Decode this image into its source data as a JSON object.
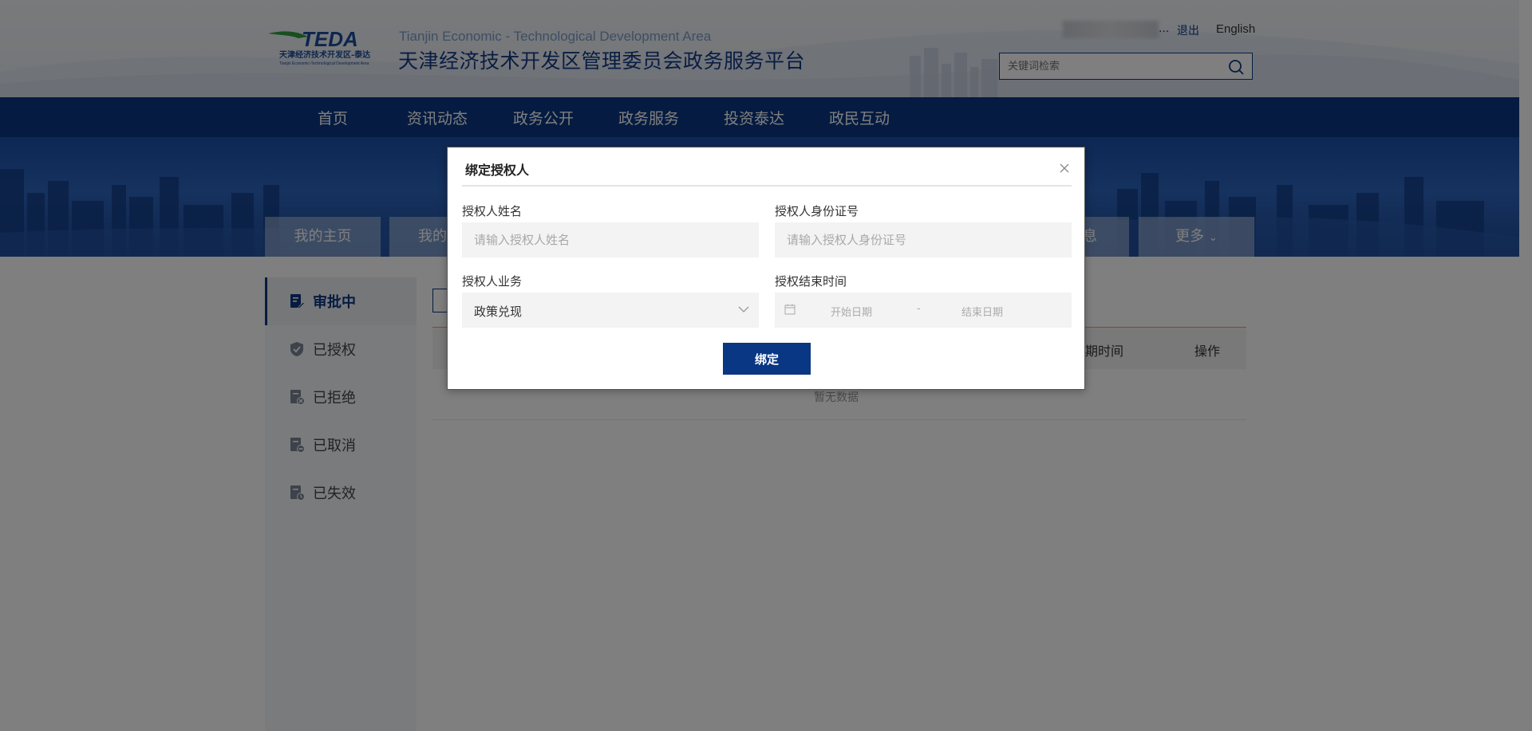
{
  "header": {
    "site_name_en": "Tianjin Economic - Technological Development Area",
    "site_name_cn": "天津经济技术开发区管理委员会政务服务平台",
    "logo_text": "TEDA",
    "logo_sub_cn": "天津经济技术开发区-泰达",
    "logo_sub_en": "Tianjin Economic-Technological Development Area",
    "user_ellipsis": "...",
    "logout_label": "退出",
    "english_label": "English",
    "search_placeholder": "关键词检索"
  },
  "nav": {
    "items": [
      "首页",
      "资讯动态",
      "政务公开",
      "政务服务",
      "投资泰达",
      "政民互动"
    ]
  },
  "tabs": {
    "items": [
      "我的主页",
      "我的",
      "息",
      "更多"
    ],
    "more_arrow": "⌄"
  },
  "sidebar": {
    "items": [
      {
        "label": "审批中",
        "icon": "document-edit-icon",
        "active": true
      },
      {
        "label": "已授权",
        "icon": "shield-check-icon",
        "active": false
      },
      {
        "label": "已拒绝",
        "icon": "document-reject-icon",
        "active": false
      },
      {
        "label": "已取消",
        "icon": "document-cancel-icon",
        "active": false
      },
      {
        "label": "已失效",
        "icon": "document-expired-icon",
        "active": false
      }
    ]
  },
  "table": {
    "columns": [
      "期时间",
      "操作"
    ],
    "empty_text": "暂无数据"
  },
  "modal": {
    "title": "绑定授权人",
    "name_label": "授权人姓名",
    "name_placeholder": "请输入授权人姓名",
    "id_label": "授权人身份证号",
    "id_placeholder": "请输入授权人身份证号",
    "business_label": "授权人业务",
    "business_value": "政策兑现",
    "end_time_label": "授权结束时间",
    "start_date_placeholder": "开始日期",
    "date_separator": "-",
    "end_date_placeholder": "结束日期",
    "submit_label": "绑定"
  },
  "colors": {
    "primary": "#0a3783",
    "accent_line": "#f0a050",
    "overlay": "rgba(0,0,0,0.5)"
  }
}
